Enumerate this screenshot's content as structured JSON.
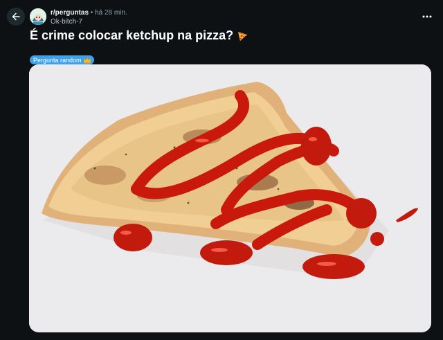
{
  "header": {
    "back_icon": "arrow-left-icon",
    "subreddit": "r/perguntas",
    "separator": "•",
    "time_ago": "há 28 min.",
    "username": "Ok-bitch-7",
    "more_icon": "ellipsis-horizontal-icon"
  },
  "post": {
    "title": "É crime colocar ketchup na pizza?",
    "title_emoji": "pizza-emoji",
    "flair": "Pergunta random",
    "flair_emoji": "crown-emoji",
    "image_alt": "pizza slice with ketchup"
  },
  "colors": {
    "background": "#0e1113",
    "flair": "#3ea2ea",
    "ketchup": "#c8190c",
    "image_background": "#ebebed"
  }
}
